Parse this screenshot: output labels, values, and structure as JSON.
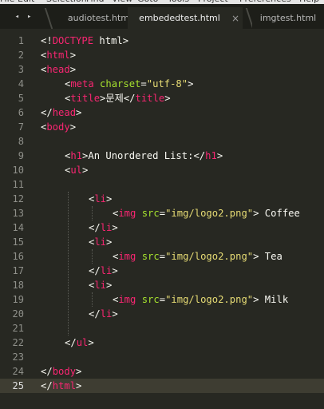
{
  "menubar": [
    "File",
    "Edit",
    "Selection",
    "Find",
    "View",
    "Goto",
    "Tools",
    "Project",
    "Preferences",
    "Help"
  ],
  "nav": {
    "back_icon": "◂",
    "forward_icon": "▸"
  },
  "tabs": [
    {
      "label": "audiotest.html"
    },
    {
      "label": "embededtest.html",
      "active": true,
      "close": "×"
    },
    {
      "label": "imgtest.html"
    }
  ],
  "lines": [
    {
      "n": "1",
      "indent": 0,
      "parts": [
        [
          "p",
          "<!"
        ],
        [
          "t",
          "DOCTYPE"
        ],
        [
          "p",
          " html>"
        ]
      ]
    },
    {
      "n": "2",
      "indent": 0,
      "parts": [
        [
          "p",
          "<"
        ],
        [
          "t",
          "html"
        ],
        [
          "p",
          ">"
        ]
      ]
    },
    {
      "n": "3",
      "indent": 0,
      "parts": [
        [
          "p",
          "<"
        ],
        [
          "t",
          "head"
        ],
        [
          "p",
          ">"
        ]
      ]
    },
    {
      "n": "4",
      "indent": 1,
      "parts": [
        [
          "p",
          "<"
        ],
        [
          "t",
          "meta "
        ],
        [
          "a",
          "charset"
        ],
        [
          "p",
          "="
        ],
        [
          "s",
          "\"utf-8\""
        ],
        [
          "p",
          ">"
        ]
      ]
    },
    {
      "n": "5",
      "indent": 1,
      "parts": [
        [
          "p",
          "<"
        ],
        [
          "t",
          "title"
        ],
        [
          "p",
          ">"
        ],
        [
          "x",
          "문제"
        ],
        [
          "p",
          "</"
        ],
        [
          "t",
          "title"
        ],
        [
          "p",
          ">"
        ]
      ]
    },
    {
      "n": "6",
      "indent": 0,
      "parts": [
        [
          "p",
          "</"
        ],
        [
          "t",
          "head"
        ],
        [
          "p",
          ">"
        ]
      ]
    },
    {
      "n": "7",
      "indent": 0,
      "parts": [
        [
          "p",
          "<"
        ],
        [
          "t",
          "body"
        ],
        [
          "p",
          ">"
        ]
      ]
    },
    {
      "n": "8",
      "indent": 0,
      "parts": []
    },
    {
      "n": "9",
      "indent": 1,
      "parts": [
        [
          "p",
          "<"
        ],
        [
          "t",
          "h1"
        ],
        [
          "p",
          ">"
        ],
        [
          "x",
          "An Unordered List:"
        ],
        [
          "p",
          "</"
        ],
        [
          "t",
          "h1"
        ],
        [
          "p",
          ">"
        ]
      ]
    },
    {
      "n": "10",
      "indent": 1,
      "parts": [
        [
          "p",
          "<"
        ],
        [
          "t",
          "ul"
        ],
        [
          "p",
          ">"
        ]
      ]
    },
    {
      "n": "11",
      "indent": 0,
      "parts": []
    },
    {
      "n": "12",
      "indent": 2,
      "parts": [
        [
          "p",
          "<"
        ],
        [
          "t",
          "li"
        ],
        [
          "p",
          ">"
        ]
      ]
    },
    {
      "n": "13",
      "indent": 3,
      "parts": [
        [
          "p",
          "<"
        ],
        [
          "t",
          "img "
        ],
        [
          "a",
          "src"
        ],
        [
          "p",
          "="
        ],
        [
          "s",
          "\"img/logo2.png\""
        ],
        [
          "p",
          ">"
        ],
        [
          "x",
          " Coffee"
        ]
      ]
    },
    {
      "n": "14",
      "indent": 2,
      "parts": [
        [
          "p",
          "</"
        ],
        [
          "t",
          "li"
        ],
        [
          "p",
          ">"
        ]
      ]
    },
    {
      "n": "15",
      "indent": 2,
      "parts": [
        [
          "p",
          "<"
        ],
        [
          "t",
          "li"
        ],
        [
          "p",
          ">"
        ]
      ]
    },
    {
      "n": "16",
      "indent": 3,
      "parts": [
        [
          "p",
          "<"
        ],
        [
          "t",
          "img "
        ],
        [
          "a",
          "src"
        ],
        [
          "p",
          "="
        ],
        [
          "s",
          "\"img/logo2.png\""
        ],
        [
          "p",
          ">"
        ],
        [
          "x",
          " Tea"
        ]
      ]
    },
    {
      "n": "17",
      "indent": 2,
      "parts": [
        [
          "p",
          "</"
        ],
        [
          "t",
          "li"
        ],
        [
          "p",
          ">"
        ]
      ]
    },
    {
      "n": "18",
      "indent": 2,
      "parts": [
        [
          "p",
          "<"
        ],
        [
          "t",
          "li"
        ],
        [
          "p",
          ">"
        ]
      ]
    },
    {
      "n": "19",
      "indent": 3,
      "parts": [
        [
          "p",
          "<"
        ],
        [
          "t",
          "img "
        ],
        [
          "a",
          "src"
        ],
        [
          "p",
          "="
        ],
        [
          "s",
          "\"img/logo2.png\""
        ],
        [
          "p",
          ">"
        ],
        [
          "x",
          " Milk"
        ]
      ]
    },
    {
      "n": "20",
      "indent": 2,
      "parts": [
        [
          "p",
          "</"
        ],
        [
          "t",
          "li"
        ],
        [
          "p",
          ">"
        ]
      ]
    },
    {
      "n": "21",
      "indent": 0,
      "parts": []
    },
    {
      "n": "22",
      "indent": 1,
      "parts": [
        [
          "p",
          "</"
        ],
        [
          "t",
          "ul"
        ],
        [
          "p",
          ">"
        ]
      ]
    },
    {
      "n": "23",
      "indent": 0,
      "parts": []
    },
    {
      "n": "24",
      "indent": 0,
      "parts": [
        [
          "p",
          "</"
        ],
        [
          "t",
          "body"
        ],
        [
          "p",
          ">"
        ]
      ]
    },
    {
      "n": "25",
      "indent": 0,
      "parts": [
        [
          "p",
          "</"
        ],
        [
          "t",
          "html"
        ],
        [
          "p",
          ">"
        ]
      ],
      "current": true
    }
  ],
  "colors": {
    "background": "#272822",
    "tag": "#f92672",
    "attr": "#a6e22e",
    "string": "#e6db74",
    "text": "#f8f8f2",
    "gutter": "#8f908a"
  }
}
